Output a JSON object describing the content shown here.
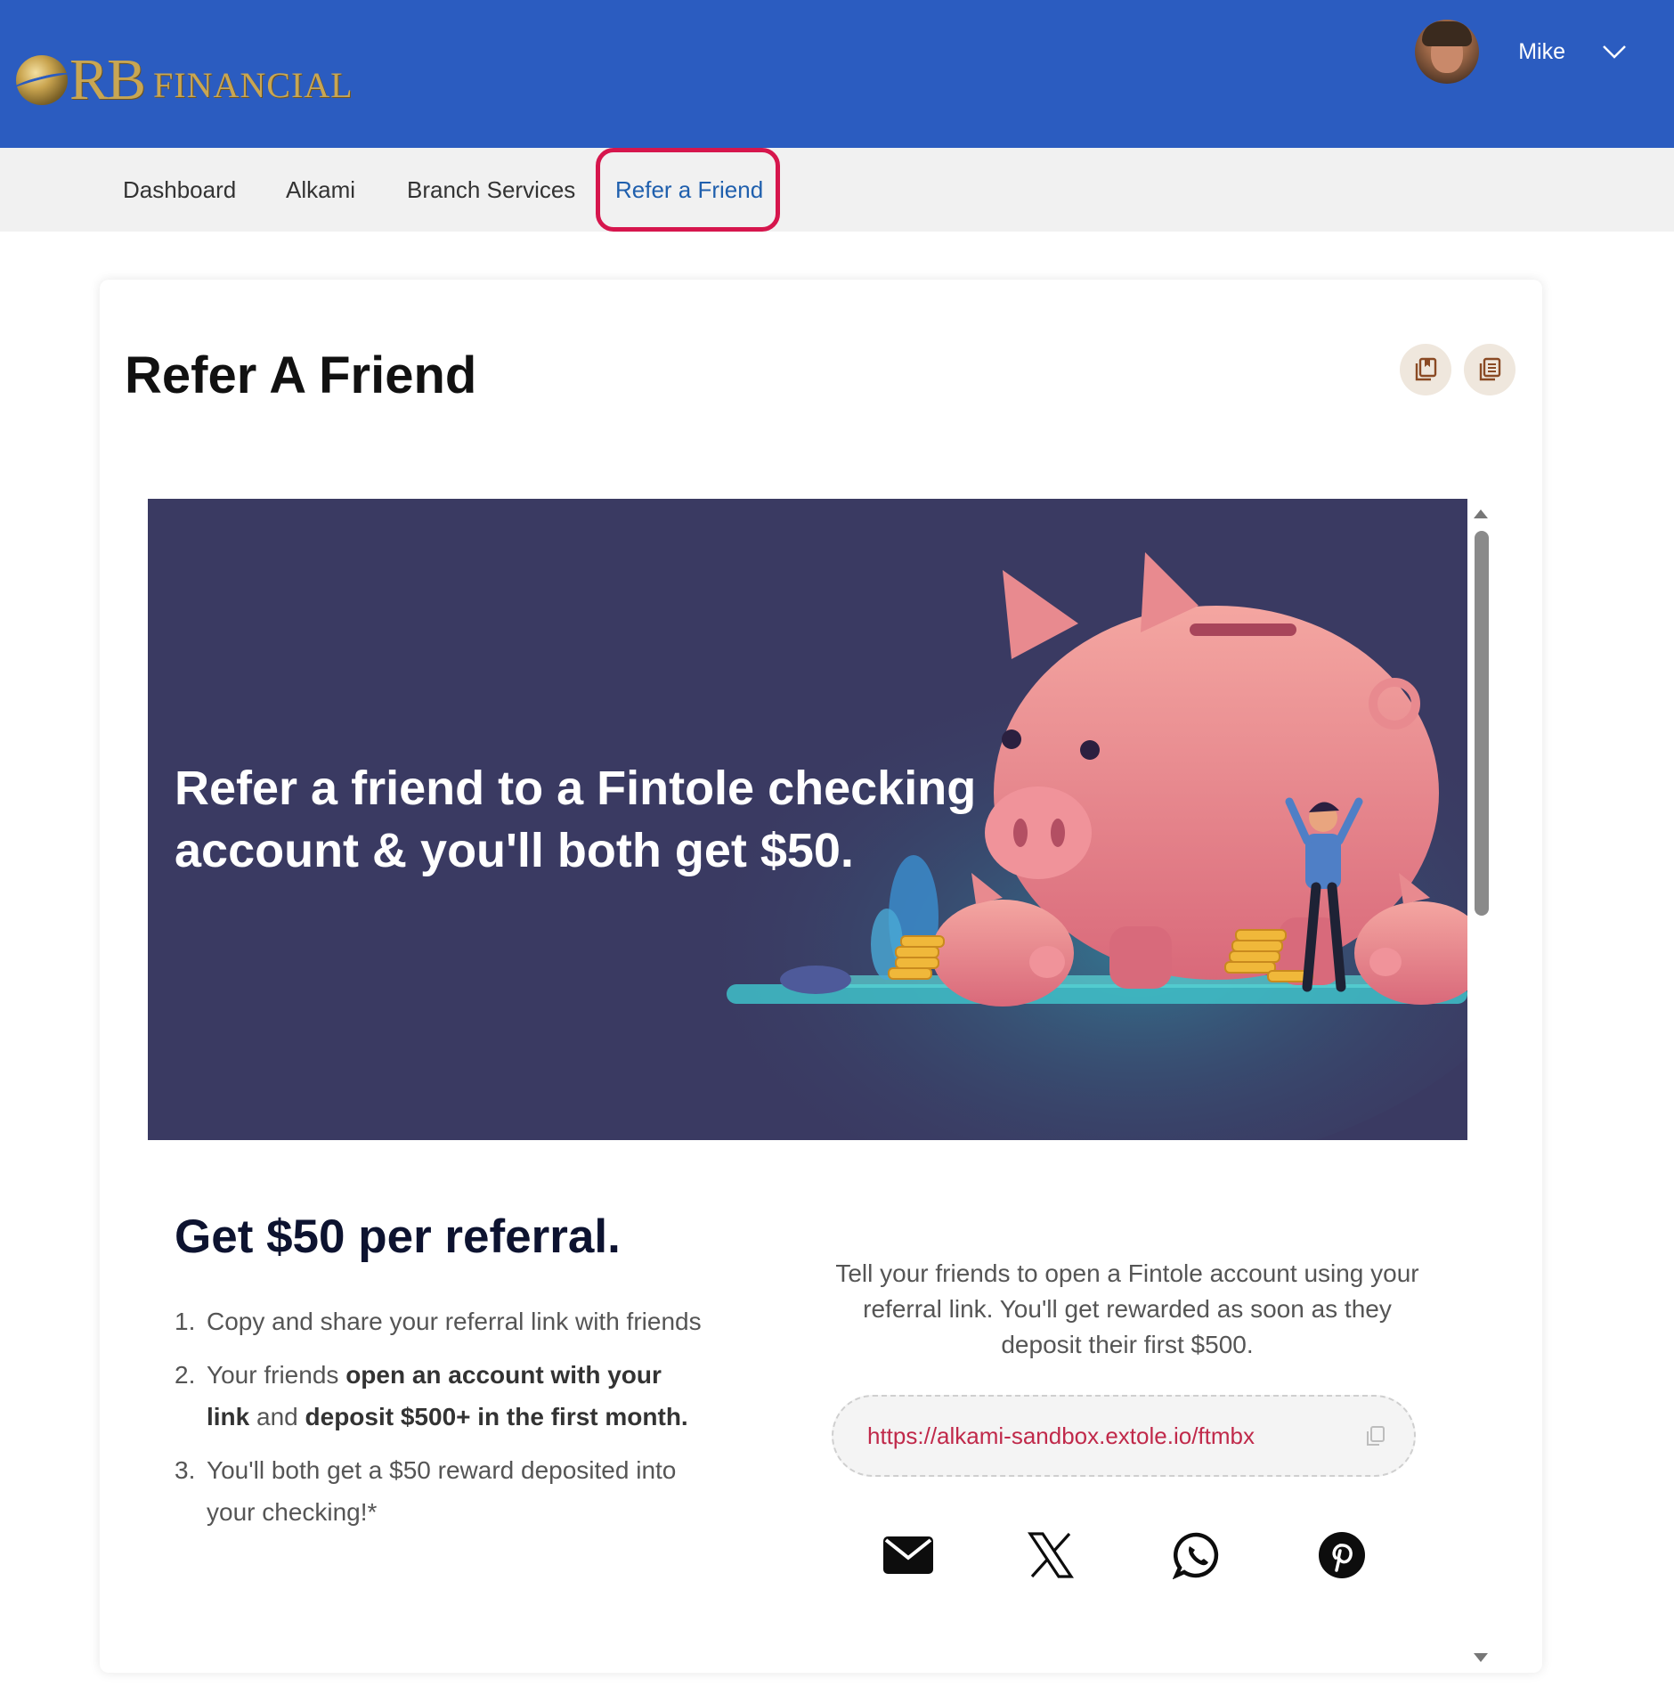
{
  "header": {
    "logo_main": "RB",
    "logo_sub": "FINANCIAL",
    "user_name": "Mike",
    "colors": {
      "header_bg": "#2b5cc0",
      "logo_gold": "#c8a653"
    }
  },
  "nav": {
    "items": [
      {
        "label": "Dashboard"
      },
      {
        "label": "Alkami"
      },
      {
        "label": "Branch Services"
      },
      {
        "label": "Refer a Friend",
        "active": true
      }
    ],
    "active_color": "#1f5fad",
    "highlight_color": "#d6164d"
  },
  "card": {
    "title": "Refer A Friend",
    "buttons": [
      {
        "icon": "bookmark-copy-icon"
      },
      {
        "icon": "document-list-icon"
      }
    ]
  },
  "referral": {
    "hero_text": "Refer a friend to a Fintole checking account & you'll both get $50.",
    "hero_bg": "#3a3a62",
    "heading": "Get $50 per referral.",
    "steps": [
      {
        "num": "1.",
        "parts": [
          {
            "t": "Copy and share your referral link with friends",
            "b": false
          }
        ]
      },
      {
        "num": "2.",
        "parts": [
          {
            "t": "Your friends ",
            "b": false
          },
          {
            "t": "open an account with your link",
            "b": true
          },
          {
            "t": " and ",
            "b": false
          },
          {
            "t": "deposit $500+ in the first month.",
            "b": true
          }
        ]
      },
      {
        "num": "3.",
        "parts": [
          {
            "t": "You'll both get a $50 reward deposited into your checking!*",
            "b": false
          }
        ]
      }
    ],
    "blurb": "Tell your friends to open a Fintole account using your referral link. You'll get rewarded as soon as they deposit their first $500.",
    "link": "https://alkami-sandbox.extole.io/ftmbx",
    "share_icons": [
      "email-icon",
      "x-twitter-icon",
      "whatsapp-icon",
      "pinterest-icon"
    ]
  }
}
